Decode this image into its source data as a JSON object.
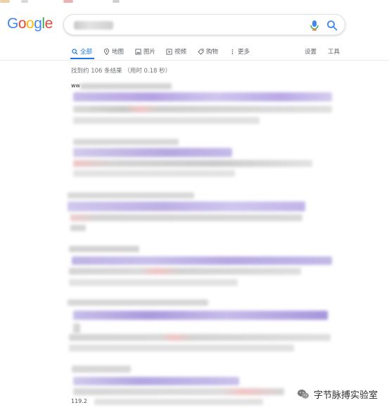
{
  "logo": {
    "letters": [
      "G",
      "o",
      "o",
      "g",
      "l",
      "e"
    ],
    "colors": [
      "#4285f4",
      "#ea4335",
      "#fbbc05",
      "#4285f4",
      "#34a853",
      "#ea4335"
    ]
  },
  "search": {
    "query_visible": false
  },
  "tabs": [
    {
      "label": "全部",
      "icon": "search-icon",
      "active": true
    },
    {
      "label": "地图",
      "icon": "map-pin-icon",
      "active": false
    },
    {
      "label": "图片",
      "icon": "image-icon",
      "active": false
    },
    {
      "label": "视频",
      "icon": "video-icon",
      "active": false
    },
    {
      "label": "购物",
      "icon": "tag-icon",
      "active": false
    },
    {
      "label": "更多",
      "icon": "more-vert-icon",
      "active": false
    }
  ],
  "tools": {
    "settings": "设置",
    "tools": "工具"
  },
  "stats": "找到约 106 条结果 （用时 0.18 秒）",
  "results": {
    "first_url_prefix": "ww",
    "last_footer": "119.2"
  },
  "watermark": "字节脉搏实验室",
  "colors": {
    "accent": "#1a73e8",
    "link_blur": "#b9a9e6",
    "highlight_blur": "#f2c6c6"
  }
}
